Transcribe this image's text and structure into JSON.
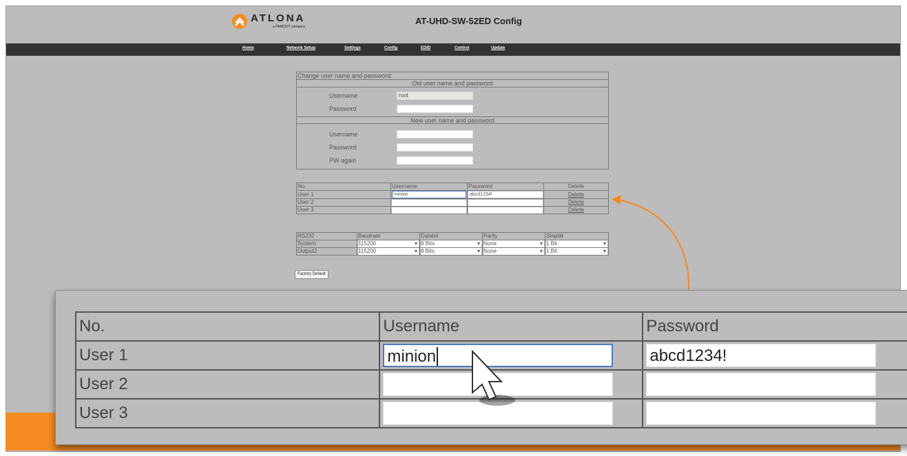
{
  "header": {
    "logo_word": "ATLONA",
    "logo_sub": "a PANDUIT company",
    "title": "AT-UHD-SW-52ED Config"
  },
  "nav": [
    "Home",
    "Network Setup",
    "Settings",
    "Config",
    "EDID",
    "Control",
    "Update"
  ],
  "credentials": {
    "section_title": "Change user name and password:",
    "old_header": "Old user name and password",
    "new_header": "New user name and password",
    "username_label": "Username",
    "password_label": "Password",
    "pw_again_label": "PW again",
    "old_username_value": "root"
  },
  "users": {
    "headers": [
      "No.",
      "Username",
      "Password",
      "Delete"
    ],
    "rows": [
      {
        "no": "User 1",
        "username": "minion",
        "password": "abcd1234!",
        "delete": "Delete"
      },
      {
        "no": "User 2",
        "username": "",
        "password": "",
        "delete": "Delete"
      },
      {
        "no": "User 3",
        "username": "",
        "password": "",
        "delete": "Delete"
      }
    ]
  },
  "rs232": {
    "headers": [
      "RS232",
      "Baudrate",
      "Databit",
      "Parity",
      "Stopbit"
    ],
    "rows": [
      {
        "name": "System",
        "baud": "115200",
        "databit": "8 Bits",
        "parity": "None",
        "stopbit": "1 Bit"
      },
      {
        "name": "Output2",
        "baud": "115200",
        "databit": "8 Bits",
        "parity": "None",
        "stopbit": "1 Bit"
      }
    ]
  },
  "factory_default_label": "Factory Default",
  "colors": {
    "accent": "#f58b20",
    "navbar": "#333333",
    "background": "#bcbcbc",
    "focus": "#4c7cc2"
  },
  "icons": [
    "atlona-logo-icon",
    "mouse-pointer-icon",
    "callout-arrow-icon",
    "dropdown-arrow-icon"
  ]
}
